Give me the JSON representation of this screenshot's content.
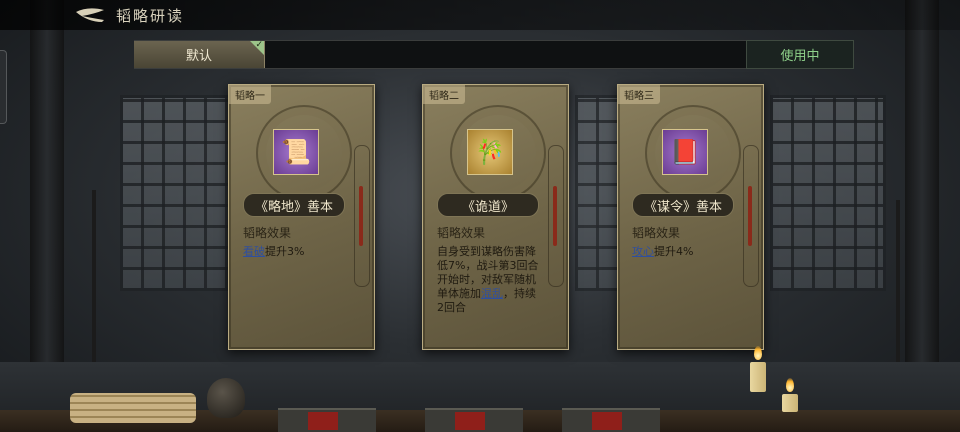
{
  "header": {
    "title": "韬略研读"
  },
  "tabs": {
    "default_label": "默认",
    "status_label": "使用中"
  },
  "cards": [
    {
      "tag": "韬略一",
      "icon": "scroll-bundle-icon",
      "rarity_color": "#7b4fa8",
      "name": "《略地》善本",
      "effect_label": "韬略效果",
      "effect_keyword": "看破",
      "effect_rest": "提升3%"
    },
    {
      "tag": "韬略二",
      "icon": "bamboo-scroll-icon",
      "rarity_color": "#c9a24a",
      "name": "《诡道》",
      "effect_label": "韬略效果",
      "effect_text_1": "自身受到谋略伤害降低7%，战斗第3回合开始时，对敌军随机单体施加",
      "effect_keyword": "混乱",
      "effect_text_2": "，持续2回合"
    },
    {
      "tag": "韬略三",
      "icon": "book-bundle-icon",
      "rarity_color": "#7b4fa8",
      "name": "《谋令》善本",
      "effect_label": "韬略效果",
      "effect_keyword": "攻心",
      "effect_rest": "提升4%"
    }
  ]
}
